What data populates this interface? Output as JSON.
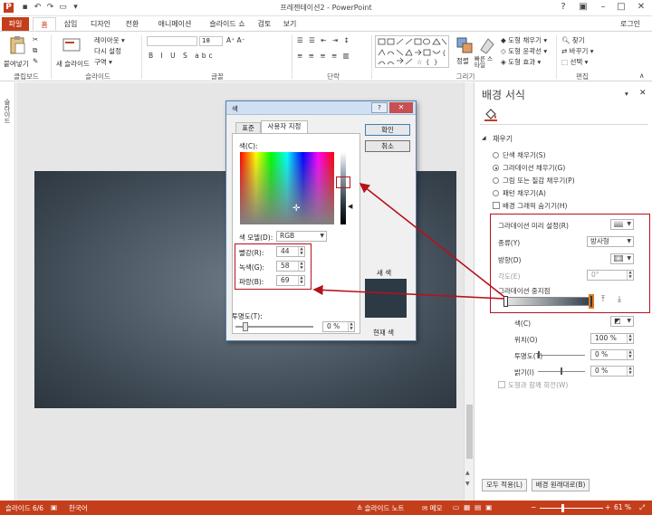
{
  "window": {
    "title": "프레젠테이션2 - PowerPoint",
    "user": "로그인"
  },
  "tabs": [
    "파일",
    "홈",
    "삽입",
    "디자인",
    "전환",
    "애니메이션",
    "슬라이드 쇼",
    "검토",
    "보기"
  ],
  "ribbon": {
    "groups": {
      "clipboard": "클립보드",
      "slides": "슬라이드",
      "font": "글꼴",
      "paragraph": "단락",
      "drawing": "그리기",
      "editing": "편집"
    },
    "paste_label": "붙여넣기",
    "new_slide_label": "새 슬라이드",
    "layout_label": "레이아웃 ▾",
    "reset_label": "다시 설정",
    "section_label": "구역 ▾",
    "font_size": "18",
    "arrange_label": "정렬",
    "quick_styles_label": "빠른 스타일",
    "shape_fill_label": "도형 채우기 ▾",
    "shape_outline_label": "도형 윤곽선 ▾",
    "shape_effects_label": "도형 효과 ▾",
    "find_label": "찾기",
    "replace_label": "바꾸기 ▾",
    "select_label": "선택 ▾"
  },
  "thumbnails_label": "슬라이드",
  "pane": {
    "title": "배경 서식",
    "fill_section": "채우기",
    "fill_options": [
      {
        "label": "단색 채우기(S)",
        "selected": false
      },
      {
        "label": "그라데이션 채우기(G)",
        "selected": true
      },
      {
        "label": "그림 또는 질감 채우기(P)",
        "selected": false
      },
      {
        "label": "패턴 채우기(A)",
        "selected": false
      }
    ],
    "hide_bg_graphics": "배경 그래픽 숨기기(H)",
    "preset_label": "그라데이션 미리 설정(R)",
    "type_label": "종류(Y)",
    "type_value": "방사형",
    "direction_label": "방향(D)",
    "angle_label": "각도(E)",
    "angle_value": "0°",
    "stops_label": "그라데이션 중지점",
    "color_label": "색(C)",
    "position_label": "위치(O)",
    "position_value": "100 %",
    "transparency_label": "투명도(T)",
    "transparency_value": "0 %",
    "brightness_label": "밝기(I)",
    "brightness_value": "0 %",
    "rotate_with_shape": "도형과 함께 회전(W)",
    "apply_all": "모두 적용(L)",
    "reset_bg": "배경 원래대로(B)"
  },
  "dialog": {
    "title": "색",
    "help": "?",
    "close": "✕",
    "tab_standard": "표준",
    "tab_custom": "사용자 지정",
    "ok": "확인",
    "cancel": "취소",
    "colors_label": "색(C):",
    "model_label": "색 모델(D):",
    "model_value": "RGB",
    "red_label": "빨강(R):",
    "red_value": "44",
    "green_label": "녹색(G):",
    "green_value": "58",
    "blue_label": "파랑(B):",
    "blue_value": "69",
    "new_label": "새 색",
    "current_label": "현재 색",
    "transparency_label": "투명도(T):",
    "transparency_value": "0 %"
  },
  "status": {
    "slide_info": "슬라이드 6/6",
    "language": "한국어",
    "notes": "슬라이드 노트",
    "comments": "메모",
    "zoom": "61 %"
  },
  "colors": {
    "accent": "#c43e1c",
    "annotation": "#b5121b",
    "selected_color": "#2c3a45"
  }
}
